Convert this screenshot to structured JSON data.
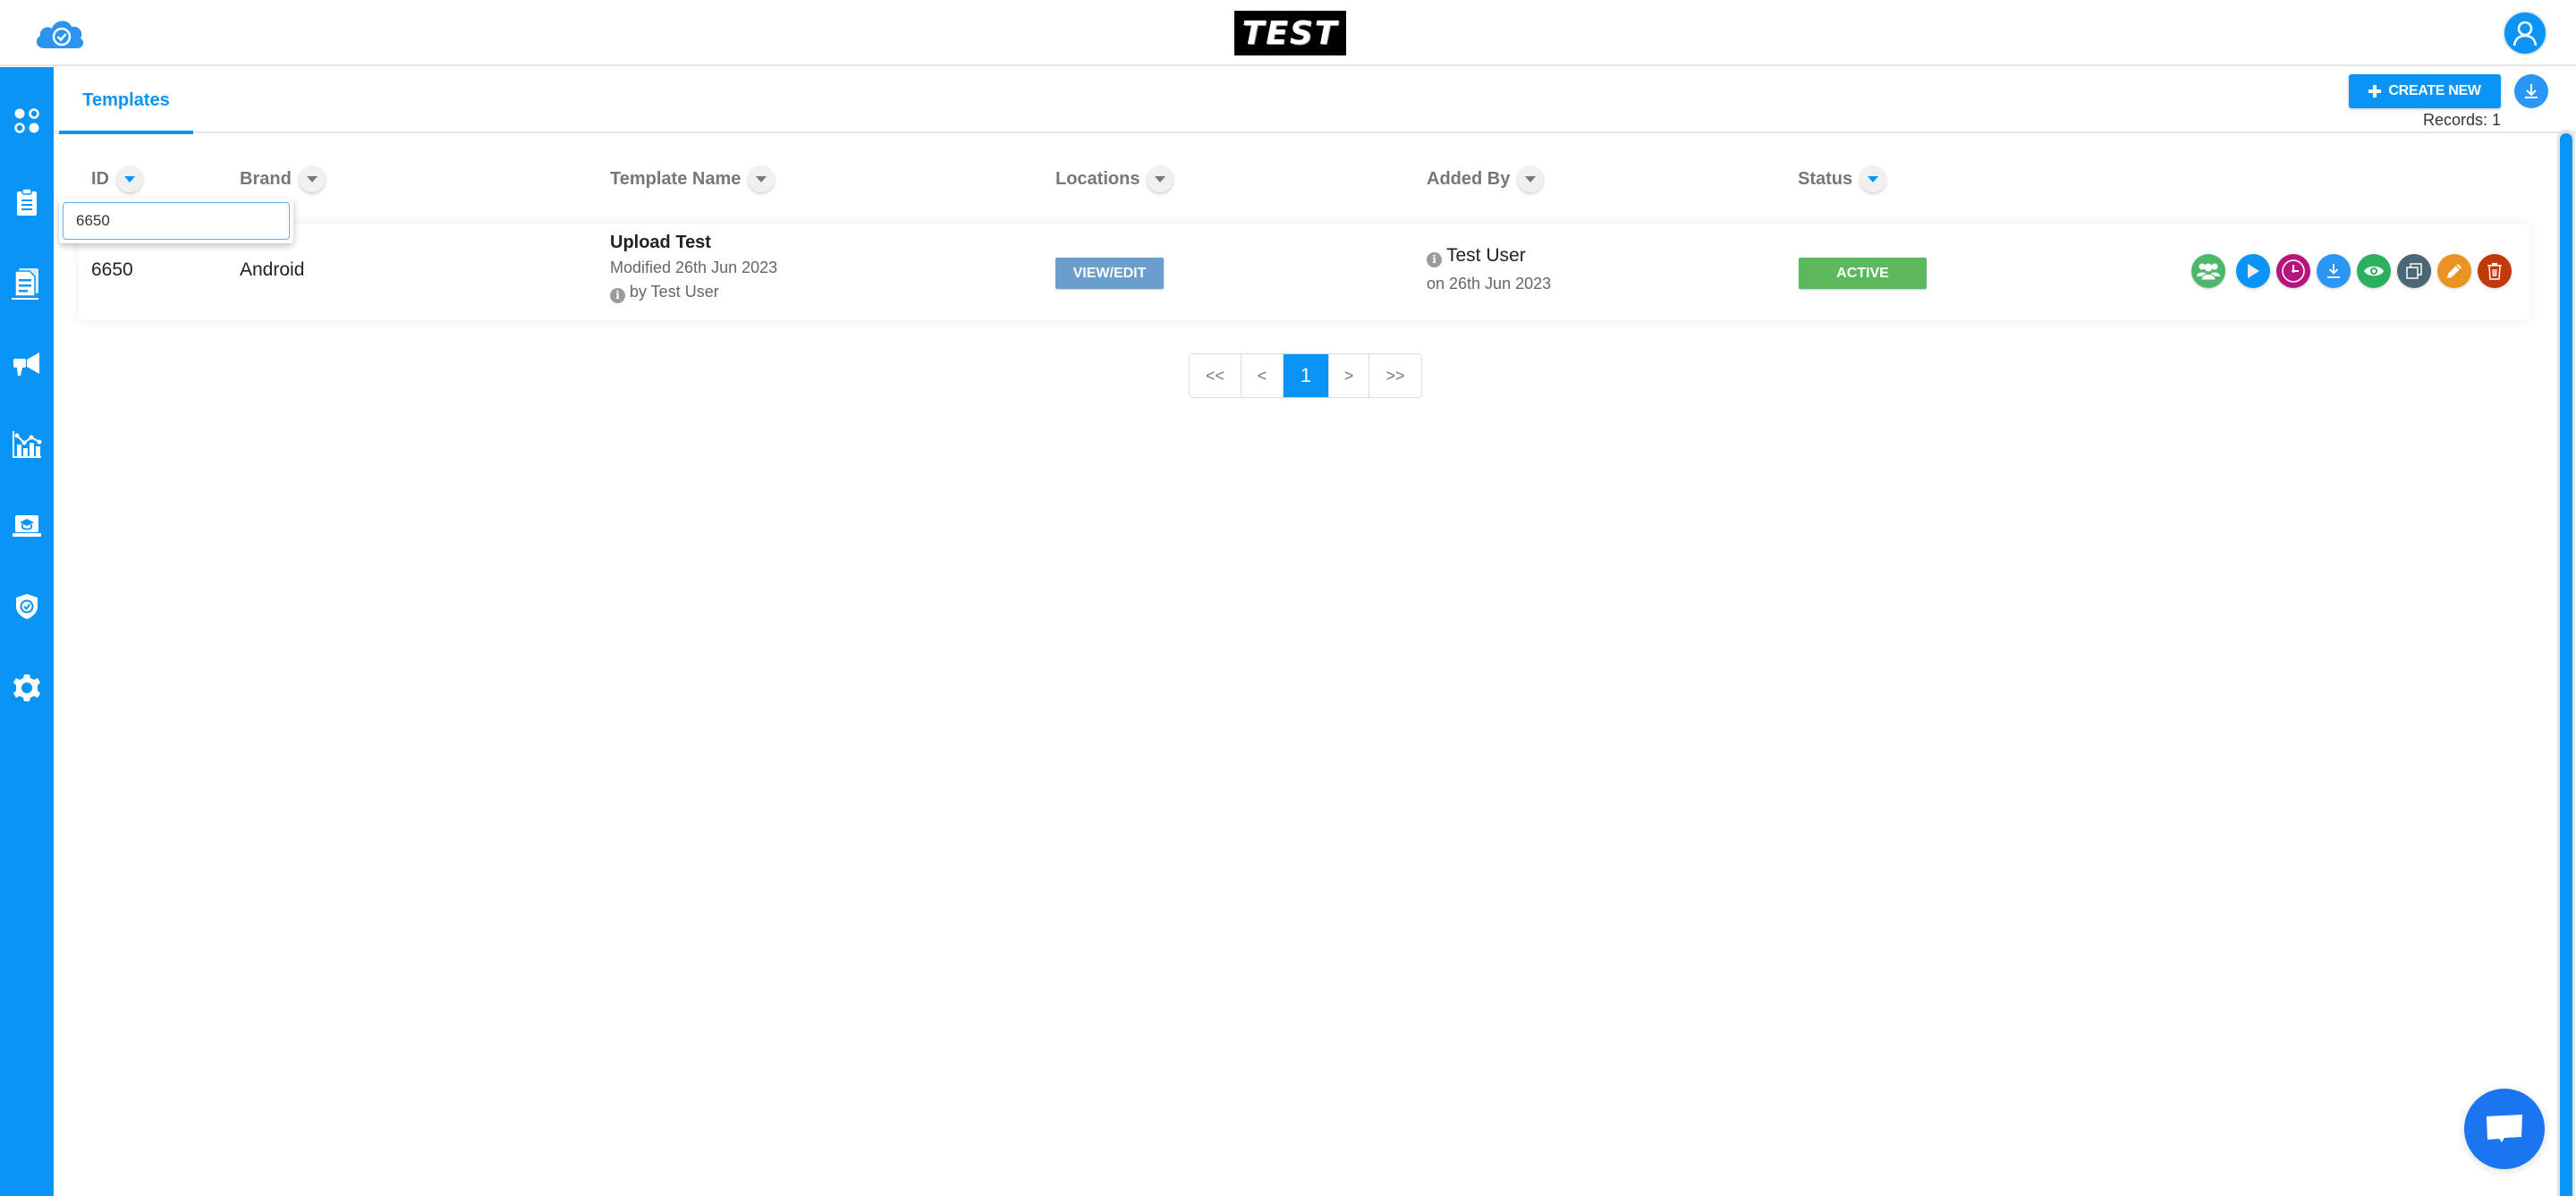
{
  "header": {
    "logo_icon": "cloud-check-icon",
    "brand_text": "TEST",
    "user_icon": "user-icon"
  },
  "sidebar": {
    "items": [
      {
        "name": "dashboard",
        "icon": "apps-dots-icon"
      },
      {
        "name": "clipboard",
        "icon": "clipboard-icon"
      },
      {
        "name": "templates",
        "icon": "documents-icon",
        "active": true
      },
      {
        "name": "campaigns",
        "icon": "megaphone-icon"
      },
      {
        "name": "analytics",
        "icon": "bar-line-chart-icon"
      },
      {
        "name": "training",
        "icon": "laptop-graduation-icon"
      },
      {
        "name": "security",
        "icon": "shield-check-icon"
      },
      {
        "name": "settings",
        "icon": "gear-icon"
      }
    ]
  },
  "tabs": [
    {
      "label": "Templates",
      "active": true
    }
  ],
  "toolbar": {
    "create_label": "CREATE NEW",
    "create_icon": "plus-icon",
    "download_icon": "download-icon",
    "records_label": "Records: 1"
  },
  "table": {
    "columns": [
      {
        "label": "ID",
        "sort_active": true
      },
      {
        "label": "Brand",
        "sort_active": false
      },
      {
        "label": "Template Name",
        "sort_active": false
      },
      {
        "label": "Locations",
        "sort_active": false
      },
      {
        "label": "Added By",
        "sort_active": false
      },
      {
        "label": "Status",
        "sort_active": true
      }
    ],
    "filter": {
      "column": "ID",
      "value": "6650"
    },
    "rows": [
      {
        "id": "6650",
        "brand": "Android",
        "template_name": "Upload Test",
        "modified": "Modified 26th Jun 2023",
        "modified_by": "by Test User",
        "locations_button": "VIEW/EDIT",
        "added_by": "Test User",
        "added_on": "on 26th Jun 2023",
        "status": "ACTIVE",
        "actions": [
          {
            "name": "assign-groups",
            "icon": "users-group-icon",
            "color": "#4cb86a"
          },
          {
            "name": "launch",
            "icon": "play-icon",
            "color": "#0a94f6"
          },
          {
            "name": "schedule",
            "icon": "clock-icon",
            "color": "#b5157e"
          },
          {
            "name": "download",
            "icon": "download-icon",
            "color": "#2a97f5"
          },
          {
            "name": "preview",
            "icon": "eye-icon",
            "color": "#2bb05f"
          },
          {
            "name": "duplicate",
            "icon": "copy-icon",
            "color": "#4b6674"
          },
          {
            "name": "edit",
            "icon": "pencil-icon",
            "color": "#e89322"
          },
          {
            "name": "delete",
            "icon": "trash-icon",
            "color": "#c2380a"
          }
        ]
      }
    ]
  },
  "pagination": {
    "first": "<<",
    "prev": "<",
    "current": "1",
    "next": ">",
    "last": ">>"
  },
  "chat": {
    "icon": "chat-bubble-icon"
  },
  "colors": {
    "primary": "#0a94f6",
    "active_status": "#5cb85c",
    "view_edit": "#6b9ecb"
  }
}
